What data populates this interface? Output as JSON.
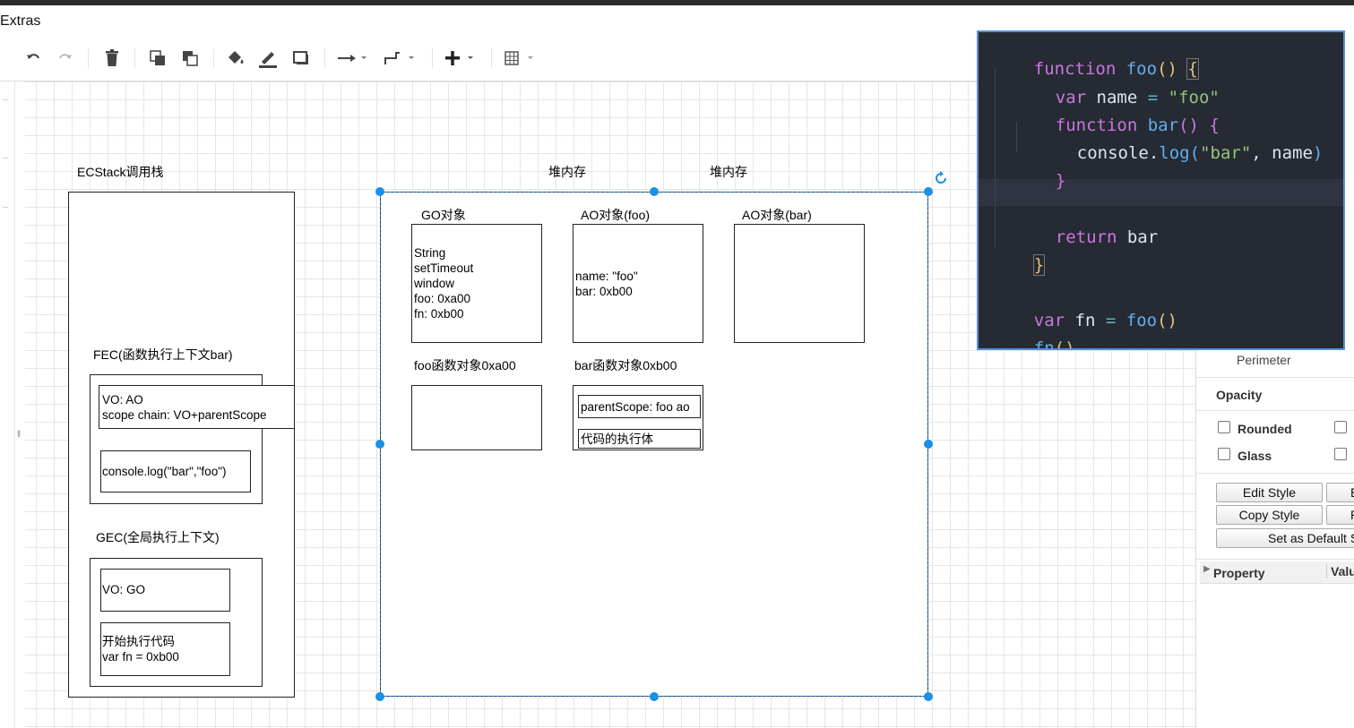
{
  "menubar": {
    "extras": "Extras"
  },
  "toolbar": {
    "items": [
      "undo-icon",
      "redo-icon",
      "delete-icon",
      "to-front-icon",
      "to-back-icon",
      "fill-color-icon",
      "line-color-icon",
      "shadow-icon",
      "connection-icon",
      "waypoints-icon",
      "insert-icon",
      "table-icon"
    ]
  },
  "diagram": {
    "ecstack_label": "ECStack调用栈",
    "heap_label_1": "堆内存",
    "heap_label_2": "堆内存",
    "go_label": "GO对象",
    "ao_foo_label": "AO对象(foo)",
    "ao_bar_label": "AO对象(bar)",
    "go_content": "String\nsetTimeout\nwindow\nfoo: 0xa00\nfn: 0xb00",
    "ao_foo_content": "name: \"foo\"\nbar: 0xb00",
    "foo_obj_label": "foo函数对象0xa00",
    "bar_obj_label": "bar函数对象0xb00",
    "bar_parent_scope": "parentScope: foo ao",
    "bar_code_body": "代码的执行体",
    "fec_label": "FEC(函数执行上下文bar)",
    "fec_vo": "VO: AO\nscope chain: VO+parentScope",
    "fec_code": "console.log(\"bar\",\"foo\")",
    "gec_label": "GEC(全局执行上下文)",
    "gec_vo": "VO: GO",
    "gec_code": "开始执行代码\nvar fn = 0xb00"
  },
  "right_panel": {
    "perimeter": "Perimeter",
    "opacity": "Opacity",
    "rounded": "Rounded",
    "glass": "Glass",
    "edit_style": "Edit Style",
    "copy_style": "Copy Style",
    "btn_e": "E",
    "btn_p": "P",
    "set_as_default": "Set as Default S",
    "property_col": "Property",
    "value_col": "Valu"
  },
  "code": {
    "lines": [
      [
        "function",
        " ",
        "foo",
        "()",
        " ",
        "{"
      ],
      [
        "var",
        " name ",
        "=",
        " ",
        "\"foo\""
      ],
      [
        "function",
        " ",
        "bar",
        "()",
        " ",
        "{"
      ],
      [
        "console",
        ".",
        "log",
        "(",
        "\"bar\"",
        ", name",
        ")"
      ],
      [
        "}"
      ],
      [
        "return",
        " bar"
      ],
      [
        "}"
      ],
      [
        "var",
        " fn ",
        "=",
        " ",
        "foo",
        "()"
      ],
      [
        "fn",
        "()"
      ]
    ]
  }
}
